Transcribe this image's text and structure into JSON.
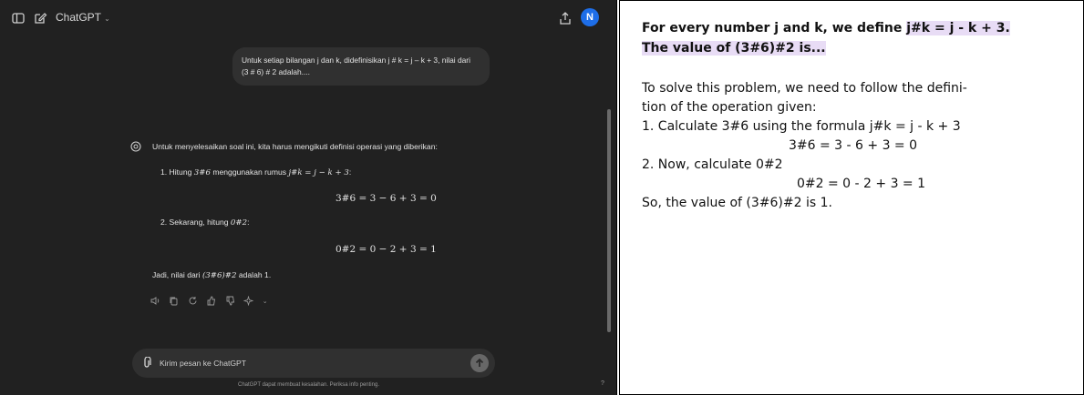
{
  "chatgpt": {
    "title": "ChatGPT",
    "avatar_initial": "N",
    "user_message": {
      "line1": "Untuk setiap bilangan j dan k, didefinisikan j # k = j – k + 3, nilai dari",
      "line2": "(3 # 6) # 2 adalah...."
    },
    "assistant": {
      "intro": "Untuk menyelesaikan soal ini, kita harus mengikuti definisi operasi yang diberikan:",
      "step1_prefix": "1.  Hitung ",
      "step1_math": "3#6",
      "step1_middle": " menggunakan rumus ",
      "step1_formula": "j#k = j − k + 3",
      "step1_suffix": ":",
      "eq1": "3#6 = 3 − 6 + 3 = 0",
      "step2_prefix": "2.  Sekarang, hitung ",
      "step2_math": "0#2",
      "step2_suffix": ":",
      "eq2": "0#2 = 0 − 2 + 3 = 1",
      "conclusion_prefix": "Jadi, nilai dari ",
      "conclusion_math": "(3#6)#2",
      "conclusion_suffix": " adalah 1."
    },
    "composer_placeholder": "Kirim pesan ke ChatGPT",
    "footer": "ChatGPT dapat membuat kesalahan. Periksa info penting.",
    "help": "?"
  },
  "translation": {
    "question_prefix": "For every number j and k, we define ",
    "question_highlight1": "j#k = j - k + 3",
    "question_dot": ".",
    "question_line2": "The value of (3#6)#2 is...",
    "intro_line1": "To solve this problem, we need to follow the defini-",
    "intro_line2": "tion of the operation given:",
    "step1": "1. Calculate 3#6 using the formula j#k = j - k + 3",
    "eq1": "3#6 = 3 - 6 + 3 = 0",
    "step2": "2. Now, calculate 0#2",
    "eq2": "0#2 = 0 - 2 + 3 = 1",
    "conclusion": "So, the value of (3#6)#2 is 1."
  }
}
